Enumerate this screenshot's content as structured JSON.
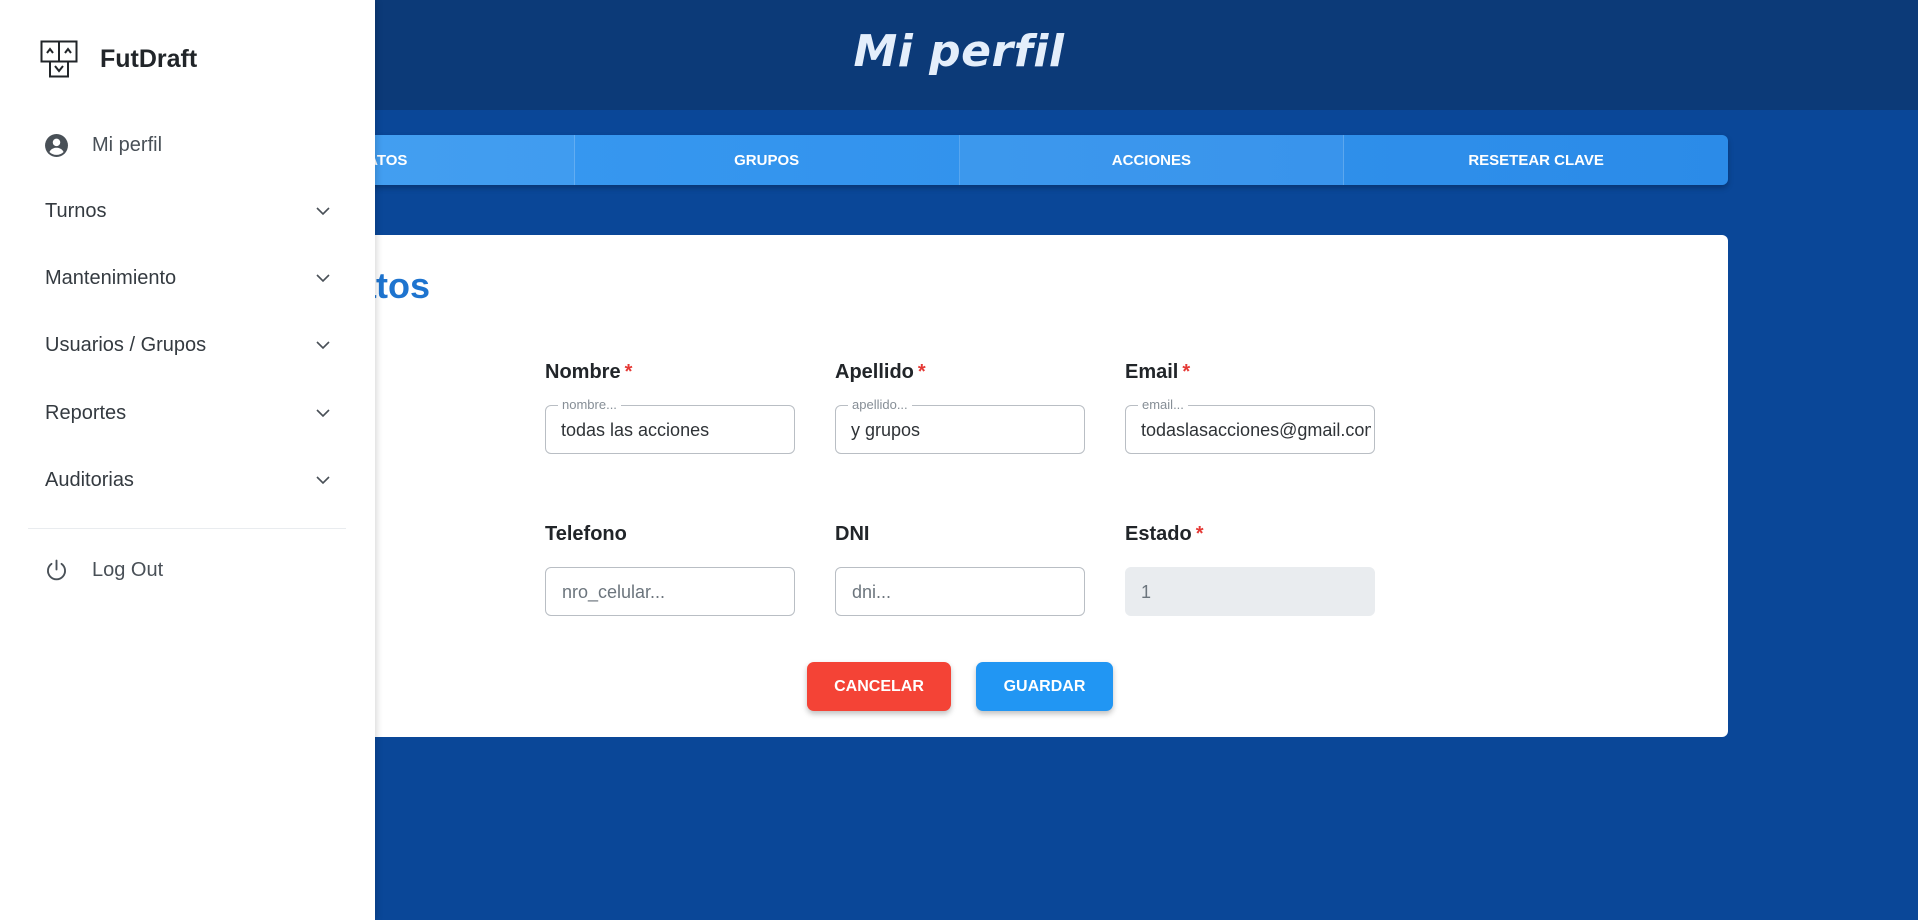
{
  "header": {
    "title": "Mi perfil"
  },
  "tabs": [
    {
      "label": "DATOS"
    },
    {
      "label": "GRUPOS"
    },
    {
      "label": "ACCIONES"
    },
    {
      "label": "RESETEAR CLAVE"
    }
  ],
  "card": {
    "title": "Datos",
    "fields": {
      "nombre": {
        "label": "Nombre",
        "required": "*",
        "legend": "nombre...",
        "value": "todas las acciones"
      },
      "apellido": {
        "label": "Apellido",
        "required": "*",
        "legend": "apellido...",
        "value": "y grupos"
      },
      "email": {
        "label": "Email",
        "required": "*",
        "legend": "email...",
        "value": "todaslasacciones@gmail.com"
      },
      "telefono": {
        "label": "Telefono",
        "placeholder": "nro_celular..."
      },
      "dni": {
        "label": "DNI",
        "placeholder": "dni..."
      },
      "estado": {
        "label": "Estado",
        "required": "*",
        "value": "1"
      }
    },
    "buttons": {
      "cancel": "CANCELAR",
      "save": "GUARDAR"
    }
  },
  "sidebar": {
    "brand": "FutDraft",
    "profile": "Mi perfil",
    "items": [
      {
        "label": "Turnos"
      },
      {
        "label": "Mantenimiento"
      },
      {
        "label": "Usuarios / Grupos"
      },
      {
        "label": "Reportes"
      },
      {
        "label": "Auditorias"
      }
    ],
    "logout": "Log Out"
  },
  "colors": {
    "header_bg": "#0c3a78",
    "page_bg": "#0a4798",
    "tab_accent": "#3a9bf2",
    "title_blue": "#1e74cf",
    "cancel": "#f44336",
    "save": "#2196f3",
    "required": "#e53935"
  }
}
